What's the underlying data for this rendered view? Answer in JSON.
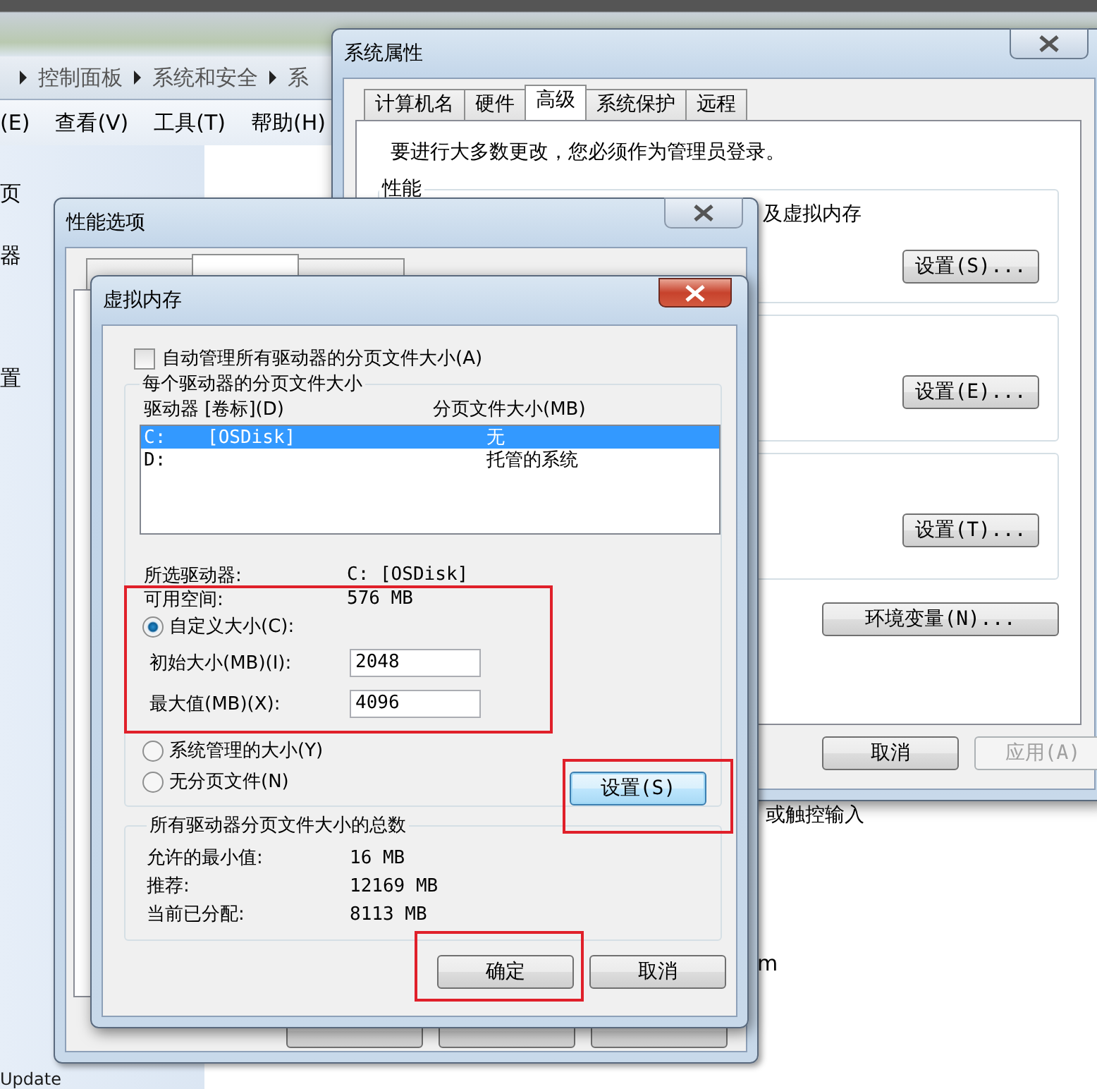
{
  "explorer": {
    "breadcrumbs": [
      "控制面板",
      "系统和安全",
      "系"
    ],
    "menu": [
      "(E)",
      "查看(V)",
      "工具(T)",
      "帮助(H)"
    ],
    "sidebar_items": [
      "页",
      "器",
      "置"
    ],
    "content_texts": [
      "或触控输入",
      "m"
    ],
    "footer_text": "Update"
  },
  "system_properties": {
    "title": "系统属性",
    "tabs": [
      {
        "label": "计算机名",
        "selected": false
      },
      {
        "label": "硬件",
        "selected": false
      },
      {
        "label": "高级",
        "selected": true
      },
      {
        "label": "系统保护",
        "selected": false
      },
      {
        "label": "远程",
        "selected": false
      }
    ],
    "notice": "要进行大多数更改，您必须作为管理员登录。",
    "groups": [
      {
        "label": "性能",
        "text": "及虚拟内存",
        "button": "设置(S)..."
      },
      {
        "button": "设置(E)..."
      },
      {
        "button": "设置(T)..."
      }
    ],
    "env_button": "环境变量(N)...",
    "buttons": [
      {
        "label": "取消",
        "disabled": false
      },
      {
        "label": "应用(A)",
        "disabled": true
      }
    ]
  },
  "performance_options": {
    "title": "性能选项",
    "tabs": [
      {
        "selected": false
      },
      {
        "selected": true
      },
      {
        "selected": false
      }
    ]
  },
  "virtual_memory": {
    "title": "虚拟内存",
    "auto_manage": {
      "label": "自动管理所有驱动器的分页文件大小(A)",
      "checked": false
    },
    "drives_group": "每个驱动器的分页文件大小",
    "columns": [
      "驱动器 [卷标](D)",
      "分页文件大小(MB)"
    ],
    "drives": [
      {
        "drive": "C:",
        "volume": "[OSDisk]",
        "size": "无",
        "selected": true
      },
      {
        "drive": "D:",
        "size": "托管的系统",
        "selected": false
      }
    ],
    "selected_drive": {
      "label": "所选驱动器:",
      "value": "C:  [OSDisk]"
    },
    "free_space": {
      "label": "可用空间:",
      "value": "576 MB"
    },
    "custom_highlighted": true,
    "size_options": [
      {
        "label": "自定义大小(C):",
        "selected": true
      },
      {
        "label": "系统管理的大小(Y)",
        "selected": false
      },
      {
        "label": "无分页文件(N)",
        "selected": false
      }
    ],
    "initial_size": {
      "label": "初始大小(MB)(I):",
      "value": "2048"
    },
    "maximum_size": {
      "label": "最大值(MB)(X):",
      "value": "4096"
    },
    "set_button": {
      "label": "设置(S)",
      "highlighted": true
    },
    "totals_group": "所有驱动器分页文件大小的总数",
    "totals": [
      {
        "label": "允许的最小值:",
        "value": "16 MB"
      },
      {
        "label": "推荐:",
        "value": "12169 MB"
      },
      {
        "label": "当前已分配:",
        "value": "8113 MB"
      }
    ],
    "buttons": [
      {
        "label": "确定",
        "highlighted": true
      },
      {
        "label": "取消",
        "highlighted": false
      }
    ]
  }
}
